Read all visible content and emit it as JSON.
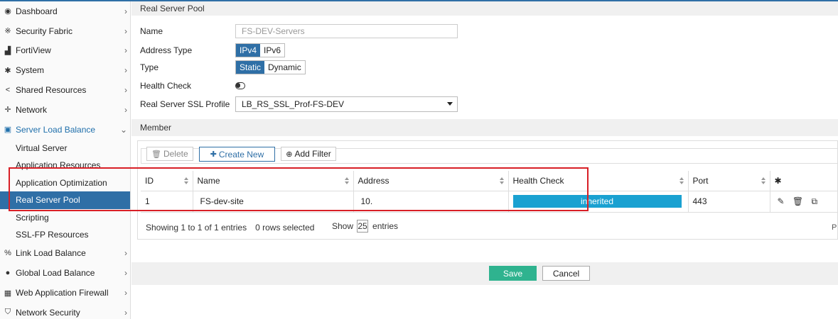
{
  "sidebar": {
    "items": [
      {
        "label": "Dashboard",
        "icon": "dashboard-icon",
        "glyph": "◉"
      },
      {
        "label": "Security Fabric",
        "icon": "security-fabric-icon",
        "glyph": "※"
      },
      {
        "label": "FortiView",
        "icon": "fortiview-icon",
        "glyph": "▟"
      },
      {
        "label": "System",
        "icon": "gear-icon",
        "glyph": "✱"
      },
      {
        "label": "Shared Resources",
        "icon": "share-icon",
        "glyph": "<"
      },
      {
        "label": "Network",
        "icon": "network-icon",
        "glyph": "✛"
      },
      {
        "label": "Server Load Balance",
        "icon": "server-load-balance-icon",
        "glyph": "▣"
      }
    ],
    "sub_items": [
      {
        "label": "Virtual Server"
      },
      {
        "label": "Application Resources"
      },
      {
        "label": "Application Optimization"
      },
      {
        "label": "Real Server Pool"
      },
      {
        "label": "Scripting"
      },
      {
        "label": "SSL-FP Resources"
      }
    ],
    "items_after": [
      {
        "label": "Link Load Balance",
        "icon": "link-icon",
        "glyph": "%"
      },
      {
        "label": "Global Load Balance",
        "icon": "globe-icon",
        "glyph": "●"
      },
      {
        "label": "Web Application Firewall",
        "icon": "firewall-icon",
        "glyph": "▦"
      },
      {
        "label": "Network Security",
        "icon": "shield-icon",
        "glyph": "⛉"
      }
    ],
    "chevron_right": "›",
    "chevron_down": "⌄"
  },
  "main": {
    "section_title": "Real Server Pool",
    "name_label": "Name",
    "name_value": "FS-DEV-Servers",
    "address_type_label": "Address Type",
    "address_type_options": [
      "IPv4",
      "IPv6"
    ],
    "type_label": "Type",
    "type_options": [
      "Static",
      "Dynamic"
    ],
    "health_check_label": "Health Check",
    "ssl_profile_label": "Real Server SSL Profile",
    "ssl_profile_value": "LB_RS_SSL_Prof-FS-DEV",
    "member_title": "Member"
  },
  "member": {
    "delete_label": "Delete",
    "create_label": "Create New",
    "filter_label": "Add Filter",
    "columns": [
      "ID",
      "Name",
      "Address",
      "Health Check",
      "Port"
    ],
    "rows": [
      {
        "id": "1",
        "name": "FS-dev-site",
        "address": "10.",
        "health": "inherited",
        "port": "443"
      }
    ],
    "footer_info": "Showing 1 to 1 of 1 entries",
    "rows_selected": "0 rows selected",
    "show_label": "Show",
    "show_value": "25",
    "entries_label": "entries",
    "edge_text": "P"
  },
  "actions": {
    "save": "Save",
    "cancel": "Cancel"
  },
  "colors": {
    "accent": "#2f6fa6",
    "save": "#2fb38f",
    "health_bar": "#1aa1d1",
    "highlight": "#d81f26"
  }
}
